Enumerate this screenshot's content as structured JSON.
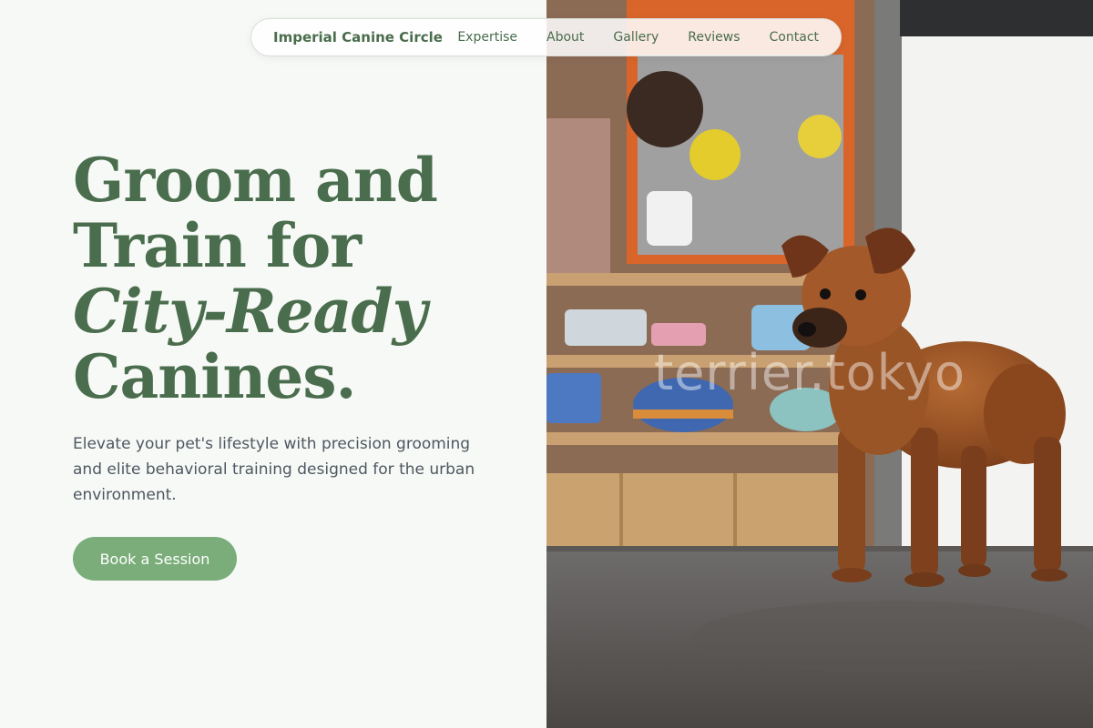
{
  "nav": {
    "brand": "Imperial Canine Circle",
    "links": [
      "Expertise",
      "About",
      "Gallery",
      "Reviews",
      "Contact"
    ]
  },
  "hero": {
    "headline_line1": "Groom and",
    "headline_line2": "Train for",
    "headline_line3_italic": "City-Ready",
    "headline_line4": "Canines.",
    "subtext": "Elevate your pet's lifestyle with precision grooming and elite behavioral training designed for the urban environment.",
    "cta_label": "Book a Session"
  },
  "photo": {
    "watermark": "terrier.tokyo",
    "subject": "brown puppy standing in a pet shop"
  },
  "colors": {
    "accent": "#4a6d4d",
    "button": "#7aad7a",
    "background": "#f7f9f6"
  }
}
